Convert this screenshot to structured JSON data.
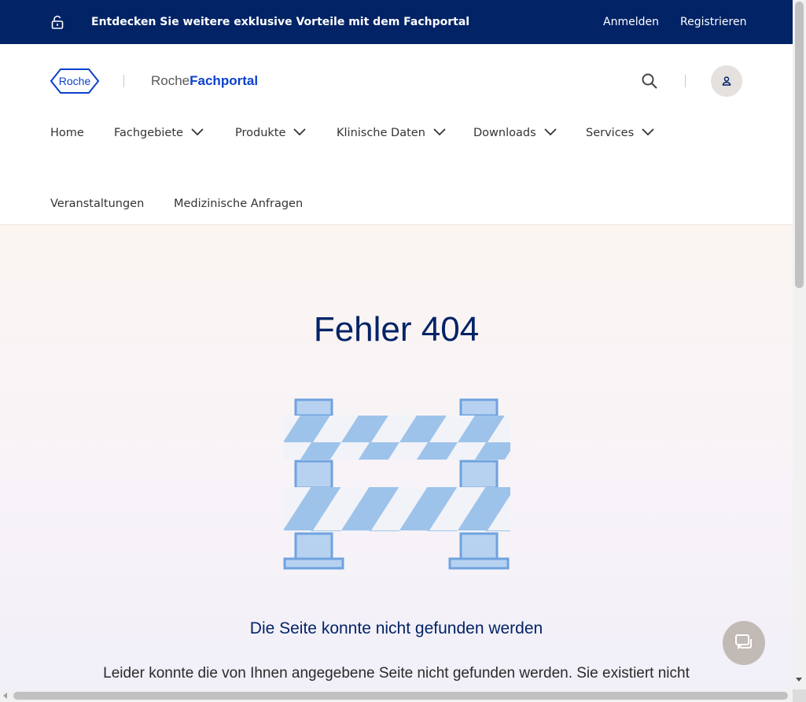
{
  "topbar": {
    "promo": "Entdecken Sie weitere exklusive Vorteile mit dem Fachportal",
    "login": "Anmelden",
    "register": "Registrieren",
    "lock_icon": "lock-open-icon",
    "background": "#022366"
  },
  "header": {
    "logo_text": "Roche",
    "portal_prefix": "Roche",
    "portal_suffix": "Fachportal",
    "brand_color": "#0b41cd",
    "search_icon": "search-icon",
    "user_icon": "user-icon"
  },
  "nav": {
    "items": [
      {
        "label": "Home"
      },
      {
        "label": "Fachgebiete"
      },
      {
        "label": "Produkte"
      },
      {
        "label": "Klinische Daten"
      },
      {
        "label": "Downloads"
      },
      {
        "label": "Services"
      },
      {
        "label": "Veranstaltungen"
      },
      {
        "label": "Medizinische Anfragen"
      }
    ]
  },
  "main": {
    "title": "Fehler 404",
    "subtitle": "Die Seite konnte nicht gefunden werden",
    "description": "Leider konnte die von Ihnen angegebene Seite nicht gefunden werden. Sie existiert nicht",
    "illustration": "barrier-icon",
    "title_color": "#022366"
  },
  "chat": {
    "icon": "chat-icon"
  }
}
